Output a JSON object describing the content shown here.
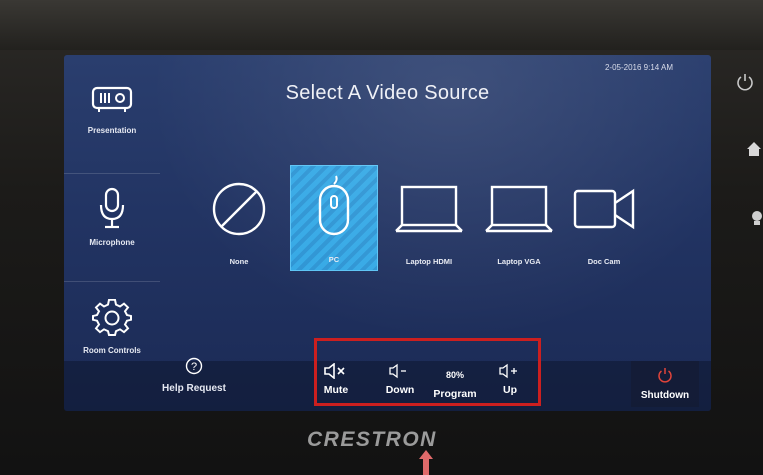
{
  "screen": {
    "title": "Select A Video Source",
    "datetime": "2-05-2016 9:14 AM"
  },
  "sidebar": {
    "items": [
      {
        "label": "Presentation",
        "icon": "projector-icon"
      },
      {
        "label": "Microphone",
        "icon": "microphone-icon"
      },
      {
        "label": "Room Controls",
        "icon": "gear-icon"
      }
    ]
  },
  "sources": [
    {
      "label": "None",
      "icon": "none-icon",
      "selected": false
    },
    {
      "label": "PC",
      "icon": "mouse-icon",
      "selected": true
    },
    {
      "label": "Laptop HDMI",
      "icon": "laptop-icon",
      "selected": false
    },
    {
      "label": "Laptop VGA",
      "icon": "laptop-icon",
      "selected": false
    },
    {
      "label": "Doc Cam",
      "icon": "camera-icon",
      "selected": false
    }
  ],
  "bottom": {
    "help_label": "Help Request",
    "mute_label": "Mute",
    "down_label": "Down",
    "volume_percent": "80%",
    "program_label": "Program",
    "up_label": "Up",
    "shutdown_label": "Shutdown"
  },
  "brand": "CRESTRON",
  "colors": {
    "screen_bg": "#223463",
    "selected_source": "#35a9e6",
    "annotation_box": "#cc1f1f",
    "shutdown_icon": "#e0443a"
  }
}
